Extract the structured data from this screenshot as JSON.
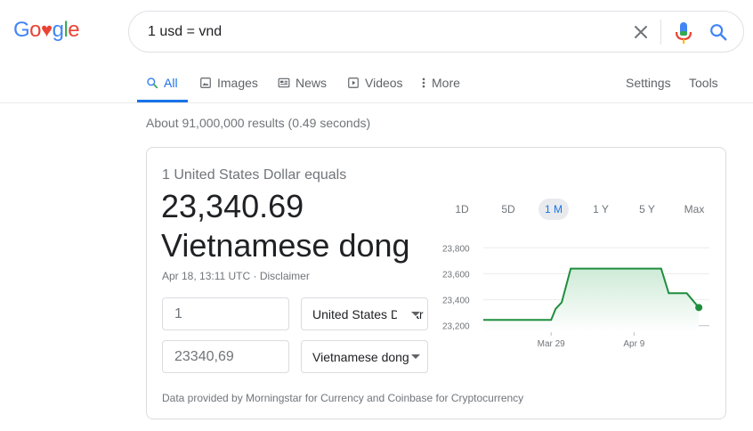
{
  "logo": {
    "letters": [
      "G",
      "o",
      "♥",
      "g",
      "l",
      "e"
    ],
    "colors": [
      "#4285f4",
      "#ea4335",
      "#ea4335",
      "#4285f4",
      "#34a853",
      "#ea4335"
    ]
  },
  "search": {
    "query": "1 usd = vnd",
    "clear_icon": "close-icon",
    "mic_icon": "microphone-icon",
    "search_icon": "search-icon"
  },
  "tabs": [
    {
      "label": "All",
      "icon": "search-icon",
      "active": true
    },
    {
      "label": "Images",
      "icon": "image-icon"
    },
    {
      "label": "News",
      "icon": "news-icon"
    },
    {
      "label": "Videos",
      "icon": "play-icon"
    },
    {
      "label": "More",
      "icon": "more-vert-icon"
    },
    {
      "label": "Settings"
    },
    {
      "label": "Tools"
    }
  ],
  "stats": "About 91,000,000 results (0.49 seconds)",
  "converter": {
    "equals_text": "1 United States Dollar equals",
    "amount": "23,340.69",
    "currency_name": "Vietnamese dong",
    "meta": "Apr 18, 13:11 UTC · Disclaimer",
    "from_value": "1",
    "from_currency": "United States Dollar",
    "to_value": "23340,69",
    "to_currency": "Vietnamese dong",
    "source_note": "Data provided by Morningstar for Currency and Coinbase for Cryptocurrency"
  },
  "ranges": [
    "1D",
    "5D",
    "1 M",
    "1 Y",
    "5 Y",
    "Max"
  ],
  "active_range": "1 M",
  "colors": {
    "accent": "#1a73e8",
    "chart_line": "#1e8e3e",
    "chart_fill": "#e6f4ea"
  },
  "chart_data": {
    "type": "line",
    "ylim": [
      23150,
      23850
    ],
    "yticks": [
      23200,
      23400,
      23600,
      23800
    ],
    "ytick_labels": [
      "23,200",
      "23,400",
      "23,600",
      "23,800"
    ],
    "xticks": [
      {
        "label": "Mar 29",
        "day": 9
      },
      {
        "label": "Apr 9",
        "day": 20
      }
    ],
    "x_range": [
      0,
      30
    ],
    "series": [
      {
        "values": [
          [
            0,
            23245
          ],
          [
            9,
            23245
          ],
          [
            9.6,
            23330
          ],
          [
            10.4,
            23380
          ],
          [
            11.6,
            23640
          ],
          [
            23.6,
            23640
          ],
          [
            24.6,
            23450
          ],
          [
            27,
            23450
          ],
          [
            28.6,
            23340
          ]
        ]
      }
    ],
    "end_point": [
      28.6,
      23340
    ]
  }
}
